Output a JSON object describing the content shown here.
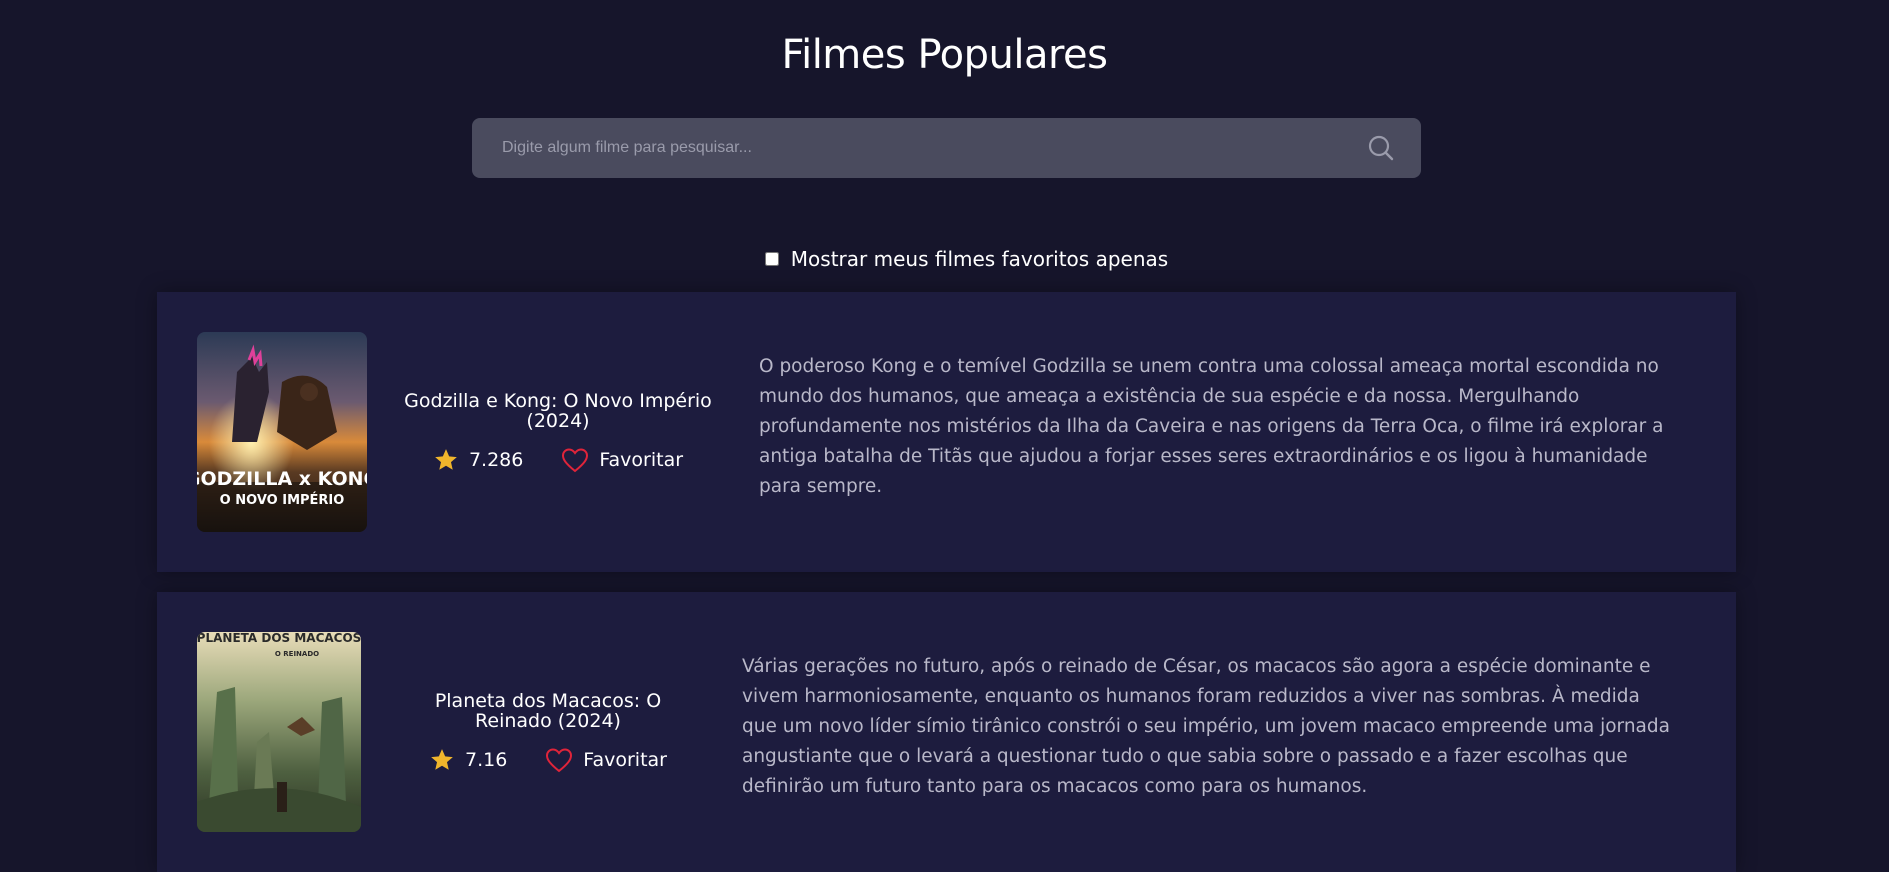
{
  "header": {
    "title": "Filmes Populares"
  },
  "search": {
    "placeholder": "Digite algum filme para pesquisar...",
    "icon": "search-icon"
  },
  "filter": {
    "label": "Mostrar meus filmes favoritos apenas",
    "checked": false
  },
  "movies": [
    {
      "title": "Godzilla e Kong: O Novo Império (2024)",
      "rating": "7.286",
      "favorite_label": "Favoritar",
      "poster_text": [
        "GODZILLA x KONG",
        "O NOVO IMPÉRIO"
      ],
      "description": "O poderoso Kong e o temível Godzilla se unem contra uma colossal ameaça mortal escondida no mundo dos humanos, que ameaça a existência de sua espécie e da nossa. Mergulhando profundamente nos mistérios da Ilha da Caveira e nas origens da Terra Oca, o filme irá explorar a antiga batalha de Titãs que ajudou a forjar esses seres extraordinários e os ligou à humanidade para sempre."
    },
    {
      "title": "Planeta dos Macacos: O Reinado (2024)",
      "rating": "7.16",
      "favorite_label": "Favoritar",
      "poster_text": [
        "PLANETA DOS MACACOS",
        "O REINADO"
      ],
      "description": "Várias gerações no futuro, após o reinado de César, os macacos são agora a espécie dominante e vivem harmoniosamente, enquanto os humanos foram reduzidos a viver nas sombras. À medida que um novo líder símio tirânico constrói o seu império, um jovem macaco empreende uma jornada angustiante que o levará a questionar tudo o que sabia sobre o passado e a fazer escolhas que definirão um futuro tanto para os macacos como para os humanos."
    }
  ],
  "colors": {
    "background": "#16152b",
    "card": "#1d1c3e",
    "search_bg": "#4a4b5e",
    "star": "#f0b52c",
    "heart": "#e0243a",
    "description_text": "#b9b8c9"
  }
}
